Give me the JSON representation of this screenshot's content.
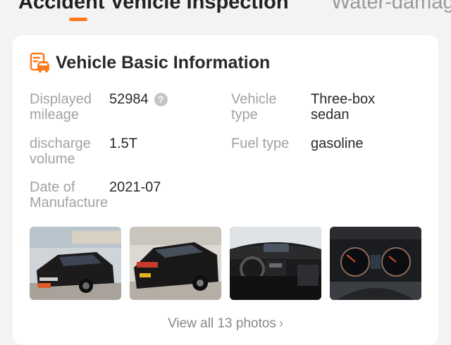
{
  "tabs": [
    {
      "label": "Accident Vehicle Inspection",
      "active": true
    },
    {
      "label": "Water-damag",
      "active": false
    }
  ],
  "card": {
    "title": "Vehicle Basic Information",
    "icon": "car-document-icon",
    "fields": {
      "mileage": {
        "label_line1": "Displayed",
        "label_line2": "mileage",
        "value": "52984",
        "help_icon": "?"
      },
      "vehicle_type": {
        "label_line1": "Vehicle",
        "label_line2": "type",
        "value_line1": "Three-box",
        "value_line2": "sedan"
      },
      "displacement": {
        "label_line1": "discharge",
        "label_line2": "volume",
        "value": "1.5T"
      },
      "fuel_type": {
        "label": "Fuel type",
        "value": "gasoline"
      },
      "manufacture_date": {
        "label_line1": "Date of",
        "label_line2": "Manufacture",
        "value": "2021-07"
      }
    },
    "photos": [
      {
        "name": "front-exterior-photo"
      },
      {
        "name": "rear-exterior-photo"
      },
      {
        "name": "interior-dashboard-photo"
      },
      {
        "name": "instrument-cluster-photo"
      }
    ],
    "view_all": "View all 13 photos",
    "view_all_icon": "chevron-right-icon"
  },
  "colors": {
    "accent": "#ff7a1a",
    "label": "#a2a2a6",
    "value": "#2a2a2a"
  }
}
